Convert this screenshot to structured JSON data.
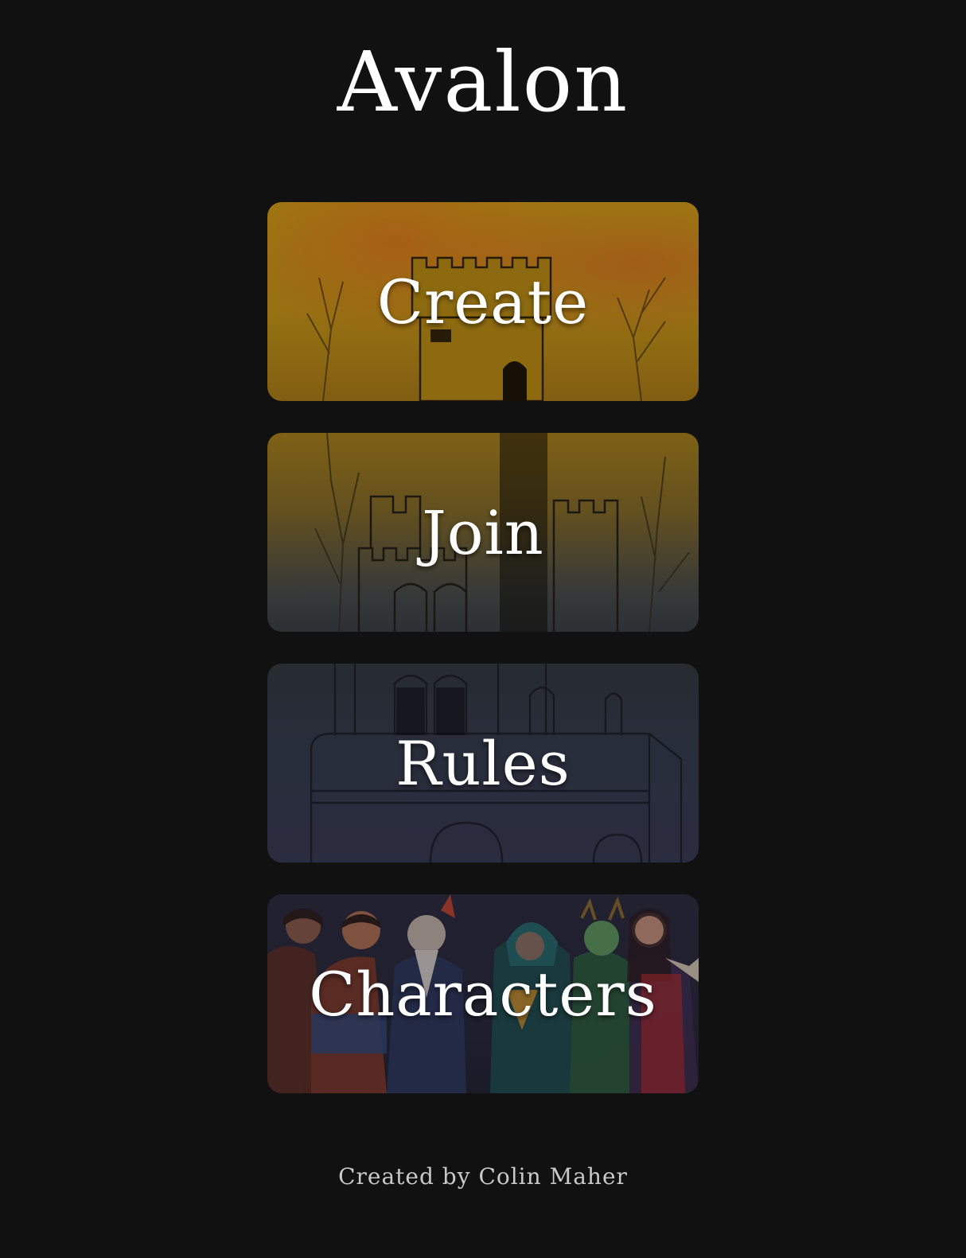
{
  "app": {
    "title": "Avalon"
  },
  "menu": {
    "items": [
      {
        "label": "Create",
        "accent": "#a98712"
      },
      {
        "label": "Join",
        "accent": "#6b5722"
      },
      {
        "label": "Rules",
        "accent": "#2c3140"
      },
      {
        "label": "Characters",
        "accent": "#242435"
      }
    ]
  },
  "footer": {
    "credit": "Created by Colin Maher"
  },
  "colors": {
    "background": "#111111",
    "text": "#ffffff",
    "footer_text": "#c9c9c9"
  }
}
